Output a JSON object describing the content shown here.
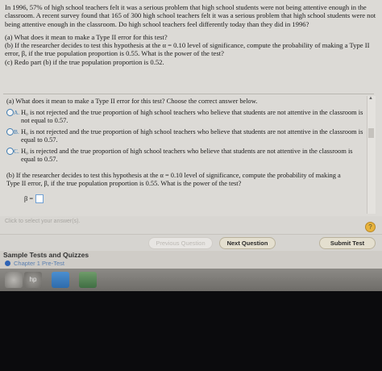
{
  "question": {
    "intro": "In 1996, 57% of high school teachers felt it was a serious problem that high school students were not being attentive enough in the classroom. A recent survey found that 165 of 300 high school teachers felt it was a serious problem that high school students were not being attentive enough in the classroom. Do high school teachers feel differently today than they did in 1996?",
    "part_a": "(a) What does it mean to make a Type II error for this test?",
    "part_b": "(b) If the researcher decides to test this hypothesis at the α = 0.10 level of significance, compute the probability of making a Type II error, β, if the true population proportion is 0.55. What is the power of the test?",
    "part_c": "(c) Redo part (b) if the true population proportion is 0.52."
  },
  "answer": {
    "head": "(a) What does it mean to make a Type II error for this test? Choose the correct answer below.",
    "choices": [
      {
        "letter": "A.",
        "text": "H₀ is not rejected and the true proportion of high school teachers who believe that students are not attentive in the classroom is not equal to 0.57."
      },
      {
        "letter": "B.",
        "text": "H₀ is not rejected and the true proportion of high school teachers who believe that students are not attentive in the classroom is equal to 0.57."
      },
      {
        "letter": "C.",
        "text": "H₀ is rejected and the true proportion of high school teachers who believe that students are not attentive in the classroom is equal to 0.57."
      }
    ],
    "part_b": "(b) If the researcher decides to test this hypothesis at the α = 0.10 level of significance, compute the probability of making a Type II error, β, if the true population proportion is 0.55. What is the power of the test?",
    "beta_label": "β ="
  },
  "footer": {
    "hint": "Click to select your answer(s).",
    "help": "?",
    "prev": "Previous Question",
    "next": "Next Question",
    "submit": "Submit Test"
  },
  "sidebar": {
    "title": "Sample Tests and Quizzes",
    "chapter": "Chapter 1 Pre-Test"
  },
  "taskbar": {
    "hp_label": "hp"
  },
  "colors": {
    "accent": "#3c7ab0",
    "help": "#e8b33c"
  }
}
